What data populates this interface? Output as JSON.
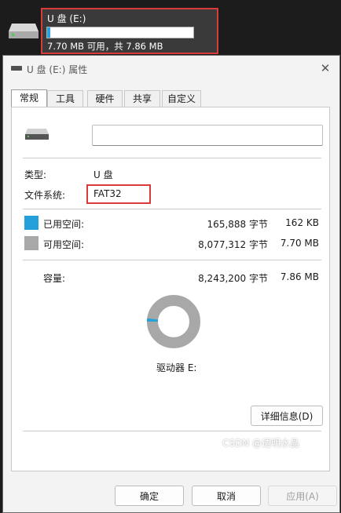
{
  "drive_tile": {
    "name": "U 盘 (E:)",
    "space_text": "7.70 MB 可用，共 7.86 MB",
    "used_fraction": 0.02,
    "bar_color": "#2aa0e0"
  },
  "dialog": {
    "title": "U 盘 (E:) 属性",
    "close_glyph": "✕",
    "tabs": [
      "常规",
      "工具",
      "硬件",
      "共享",
      "自定义"
    ],
    "active_tab": "常规",
    "volume_name_value": "",
    "type_label": "类型:",
    "type_value": "U 盘",
    "fs_label": "文件系统:",
    "fs_value": "FAT32",
    "used": {
      "label": "已用空间:",
      "bytes": "165,888 字节",
      "size": "162 KB",
      "color": "#26a0da"
    },
    "free": {
      "label": "可用空间:",
      "bytes": "8,077,312 字节",
      "size": "7.70 MB",
      "color": "#a8a8a8"
    },
    "capacity": {
      "label": "容量:",
      "bytes": "8,243,200 字节",
      "size": "7.86 MB"
    },
    "drive_label": "驱动器 E:",
    "details_button": "详细信息(D)",
    "ok_button": "确定",
    "cancel_button": "取消",
    "apply_button": "应用(A)",
    "used_fraction": 0.02
  },
  "watermark": "CSDN @透明水晶"
}
